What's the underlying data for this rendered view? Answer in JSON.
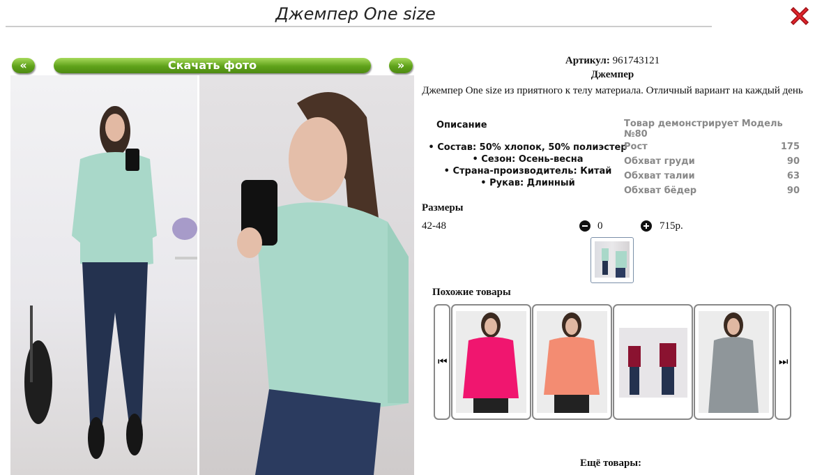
{
  "header": {
    "title": "Джемпер One size",
    "close_icon": "close-x-icon",
    "close_color": "#e0242b"
  },
  "gallery": {
    "prev_label": "«",
    "download_label": "Скачать фото",
    "next_label": "»",
    "accent": "#5fa21a"
  },
  "product": {
    "article_label": "Артикул:",
    "article_value": "961743121",
    "name": "Джемпер",
    "summary": "Джемпер One size из приятного к телу материала. Отличный вариант на каждый день"
  },
  "description": {
    "heading": "Описание",
    "items": [
      "Состав: 50% хлопок, 50% полиэстер",
      "Сезон: Осень-весна",
      "Страна-производитель: Китай",
      "Рукав: Длинный"
    ]
  },
  "model": {
    "heading": "Товар демонстрирует Модель №80",
    "rows": [
      {
        "label": "Рост",
        "value": "175"
      },
      {
        "label": "Обхват груди",
        "value": "90"
      },
      {
        "label": "Обхват талии",
        "value": "63"
      },
      {
        "label": "Обхват бёдер",
        "value": "90"
      }
    ]
  },
  "sizes": {
    "heading": "Размеры",
    "size": "42-48",
    "quantity": "0",
    "price": "715р."
  },
  "similar": {
    "heading": "Похожие товары",
    "prev_icon": "arrow-left-icon",
    "next_icon": "arrow-right-icon"
  },
  "more": {
    "heading": "Ещё товары:"
  }
}
